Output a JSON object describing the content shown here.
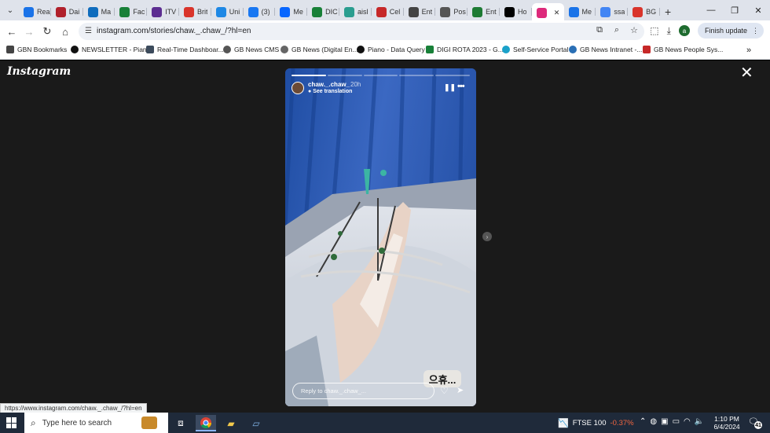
{
  "tabs": [
    {
      "label": "Rea",
      "color": "#1a73e8"
    },
    {
      "label": "Dai",
      "color": "#b0202b"
    },
    {
      "label": "Ma",
      "color": "#0f6cbd"
    },
    {
      "label": "Fac",
      "color": "#188038"
    },
    {
      "label": "ITV",
      "color": "#5c2d91"
    },
    {
      "label": "Brit",
      "color": "#d9342b"
    },
    {
      "label": "Uni",
      "color": "#1e88e5"
    },
    {
      "label": "(3)",
      "color": "#1877f2"
    },
    {
      "label": "Me",
      "color": "#0866ff"
    },
    {
      "label": "DIC",
      "color": "#188038"
    },
    {
      "label": "aisl",
      "color": "#2a9d8f"
    },
    {
      "label": "Cel",
      "color": "#c62828"
    },
    {
      "label": "Ent",
      "color": "#444444"
    },
    {
      "label": "Pos",
      "color": "#555555"
    },
    {
      "label": "Ent",
      "color": "#1e7b34"
    },
    {
      "label": "Ho",
      "color": "#000000"
    },
    {
      "label": "",
      "color": "#dd2a7b",
      "active": true
    },
    {
      "label": "Me",
      "color": "#1a73e8"
    },
    {
      "label": "ssa",
      "color": "#4285f4"
    },
    {
      "label": "BG",
      "color": "#d9342b"
    }
  ],
  "browser": {
    "new_tab": "+",
    "url": "instagram.com/stories/chaw._.chaw_/?hl=en",
    "finish_update": "Finish update",
    "profile_initial": "a",
    "status_url": "https://www.instagram.com/chaw._.chaw_/?hl=en"
  },
  "bookmarks": [
    {
      "label": "GBN Bookmarks",
      "color": "#444444",
      "shape": "folder"
    },
    {
      "label": "NEWSLETTER - Piano",
      "color": "#111111",
      "shape": "dot"
    },
    {
      "label": "Real-Time Dashboar...",
      "color": "#3c4b5c",
      "shape": "sq"
    },
    {
      "label": "GB News CMS",
      "color": "#555555",
      "shape": "dot"
    },
    {
      "label": "GB News (Digital En...",
      "color": "#666666",
      "shape": "dot"
    },
    {
      "label": "Piano - Data Query",
      "color": "#111111",
      "shape": "dot"
    },
    {
      "label": "DIGI ROTA 2023 - G...",
      "color": "#188038",
      "shape": "sq"
    },
    {
      "label": "Self-Service Portal",
      "color": "#1aa1c9",
      "shape": "dot"
    },
    {
      "label": "GB News Intranet -...",
      "color": "#2a6fb5",
      "shape": "dot"
    },
    {
      "label": "GB News People Sys...",
      "color": "#c62828",
      "shape": "sq"
    }
  ],
  "instagram": {
    "logo": "Instagram",
    "story": {
      "username": "chaw._.chaw_",
      "time": "20h",
      "see_translation": "See translation",
      "sticker_text": "으휴...",
      "reply_placeholder": "Reply to chaw._.chaw_...",
      "segments_total": 5,
      "segments_done": 1
    }
  },
  "taskbar": {
    "search_placeholder": "Type here to search",
    "ticker_name": "FTSE 100",
    "ticker_change": "-0.37%",
    "time": "1:10 PM",
    "date": "6/4/2024",
    "notifications": "41"
  }
}
